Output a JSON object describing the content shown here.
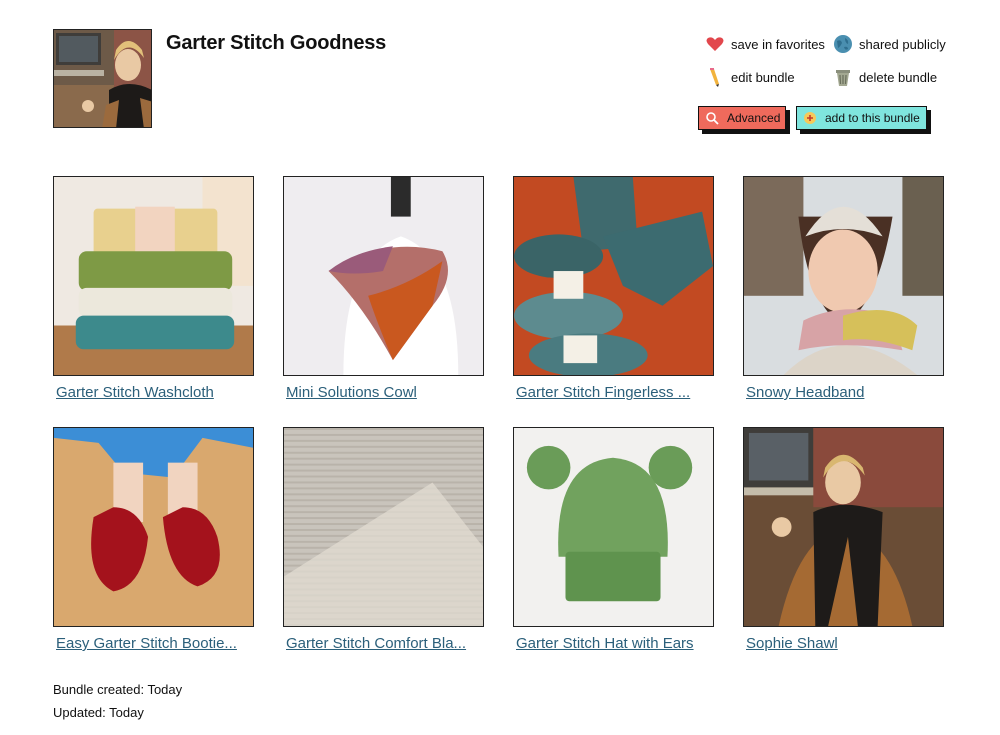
{
  "bundle": {
    "title": "Garter Stitch Goodness",
    "avatar": "profile-photo"
  },
  "actions": {
    "save_favorites": "save in favorites",
    "shared_publicly": "shared publicly",
    "edit_bundle": "edit bundle",
    "delete_bundle": "delete bundle"
  },
  "buttons": {
    "advanced": "Advanced",
    "add_to_bundle": "add to this bundle"
  },
  "items": [
    {
      "label": "Garter Stitch Washcloth",
      "image": "stacked-washcloths-photo"
    },
    {
      "label": "Mini Solutions Cowl",
      "image": "cowl-on-mannequin-photo"
    },
    {
      "label": "Garter Stitch Fingerless ...",
      "image": "fingerless-mitts-photo"
    },
    {
      "label": "Snowy Headband",
      "image": "woman-in-headband-photo"
    },
    {
      "label": "Easy Garter Stitch Bootie...",
      "image": "red-booties-photo"
    },
    {
      "label": "Garter Stitch Comfort Bla...",
      "image": "blanket-texture-photo"
    },
    {
      "label": "Garter Stitch Hat with Ears",
      "image": "green-bear-hat-photo"
    },
    {
      "label": "Sophie Shawl",
      "image": "woman-in-shawl-photo"
    }
  ],
  "meta": {
    "created": "Bundle created: Today",
    "updated": "Updated: Today"
  },
  "colors": {
    "link": "#2b5f7a",
    "advanced_button": "#ef6a5c",
    "add_button": "#7fe5de"
  }
}
